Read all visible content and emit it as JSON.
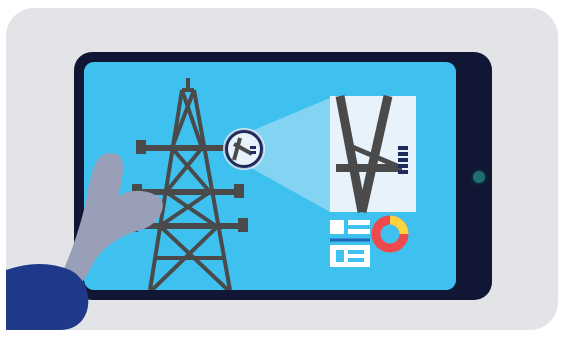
{
  "colors": {
    "page_background": "#e2e4e8",
    "tablet_frame": "#101634",
    "screen": "#3ec1ee",
    "tower": "#4a4a4a",
    "inspection_panel": "#e8f2fa",
    "magnifier_beam": "#8fd6f3",
    "hand": "#9a9fb8",
    "sleeve": "#1f3a8a",
    "chart_red": "#ee4a4e",
    "chart_yellow": "#ffd23f",
    "chart_teal": "#2d9bb2",
    "ui_card": "#ffffff"
  },
  "icons": {
    "tower": "transmission-tower-icon",
    "magnifier": "magnifier-lens-icon",
    "detail": "insulator-detail-icon",
    "donut": "donut-chart-icon",
    "list": "list-card-icon",
    "grid": "grid-card-icon"
  }
}
